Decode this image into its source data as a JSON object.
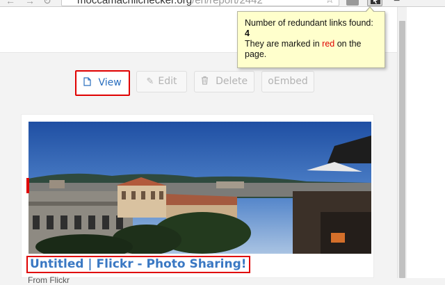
{
  "browser": {
    "url_host": "moccamachlichecker.org",
    "url_path": "/en/report/2442"
  },
  "toolbar": {
    "view_label": "View",
    "edit_label": "Edit",
    "delete_label": "Delete",
    "oembed_label": "oEmbed"
  },
  "tooltip": {
    "line1_prefix": "Number of redundant links found: ",
    "count": "4",
    "line2_prefix": "They are marked in ",
    "line2_red": "red",
    "line2_suffix": " on the page."
  },
  "card": {
    "title": "Untitled | Flickr - Photo Sharing!",
    "subtitle": "From Flickr"
  },
  "colors": {
    "highlight": "#e00000",
    "link": "#3a78c3",
    "tooltip_bg": "#ffffcc"
  },
  "icons": [
    "back-arrow-icon",
    "forward-arrow-icon",
    "reload-icon",
    "star-icon",
    "extension-icon",
    "menu-icon",
    "document-icon",
    "edit-icon",
    "trash-icon"
  ]
}
